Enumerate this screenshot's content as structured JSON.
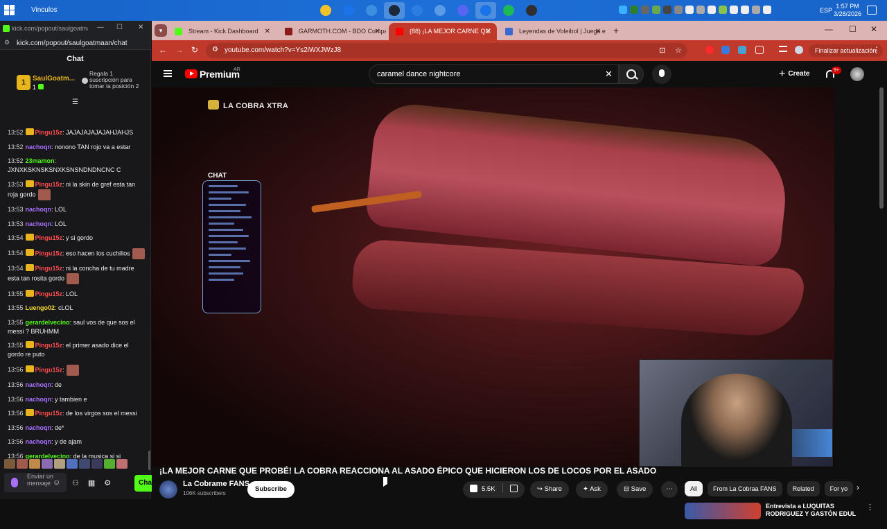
{
  "taskbar": {
    "window_title": "Vinculos",
    "language": "ESP",
    "time": "1:57 PM",
    "date": "3/28/2026",
    "apps": [
      "file-explorer-icon",
      "chrome-icon",
      "copilot-icon",
      "steam-icon",
      "store-icon",
      "photos-icon",
      "discord-icon",
      "chrome-alt-icon",
      "spotify-icon",
      "obs-icon"
    ]
  },
  "popup": {
    "title": "kick.com/popout/saulgoatma...",
    "url": "kick.com/popout/saulgoatmaan/chat",
    "chat_heading": "Chat",
    "pinned": {
      "badge": "1",
      "name": "SaulGoatm...",
      "count": "1",
      "text": "Regala 1 suscripción para tomar la posición 2"
    },
    "messages": [
      {
        "ts": "13:52",
        "user": "Pingu15z",
        "cls": "c-pingu",
        "crown": true,
        "text": ": JAJAJAJAJAJAHJAHJS"
      },
      {
        "ts": "13:52",
        "user": "nachoqn",
        "cls": "c-nacho",
        "crown": false,
        "text": ": nonono TAN rojo va a estar"
      },
      {
        "ts": "13:52",
        "user": "23mamon",
        "cls": "c-green",
        "crown": false,
        "text": ": JXNXKSKNSKSNXKSNSNDNDNCNC C"
      },
      {
        "ts": "13:53",
        "user": "Pingu15z",
        "cls": "c-pingu",
        "crown": true,
        "text": ": ni la skin de gref esta tan roja gordo",
        "emote": true
      },
      {
        "ts": "13:53",
        "user": "nachoqn",
        "cls": "c-nacho",
        "crown": false,
        "text": ": LOL"
      },
      {
        "ts": "13:53",
        "user": "nachoqn",
        "cls": "c-nacho",
        "crown": false,
        "text": ": LOL"
      },
      {
        "ts": "13:54",
        "user": "Pingu15z",
        "cls": "c-pingu",
        "crown": true,
        "text": ": y si gordo"
      },
      {
        "ts": "13:54",
        "user": "Pingu15z",
        "cls": "c-pingu",
        "crown": true,
        "text": ": eso hacen los cuchillos",
        "emote": true
      },
      {
        "ts": "13:54",
        "user": "Pingu15z",
        "cls": "c-pingu",
        "crown": true,
        "text": ": ni la concha de tu madre esta tan rosita gordo",
        "emote": true
      },
      {
        "ts": "13:55",
        "user": "Pingu15z",
        "cls": "c-pingu",
        "crown": true,
        "text": ": LOL"
      },
      {
        "ts": "13:55",
        "user": "Luengo02",
        "cls": "c-luengo",
        "crown": false,
        "text": ": cLOL"
      },
      {
        "ts": "13:55",
        "user": "gerardelvecino",
        "cls": "c-green",
        "crown": false,
        "text": ": saul vos de que sos el messi ? BRUHMM"
      },
      {
        "ts": "13:55",
        "user": "Pingu15z",
        "cls": "c-pingu",
        "crown": true,
        "text": ": el primer asado dice el gordo re puto"
      },
      {
        "ts": "13:56",
        "user": "Pingu15z",
        "cls": "c-pingu",
        "crown": true,
        "text": ":",
        "emote": true
      },
      {
        "ts": "13:56",
        "user": "nachoqn",
        "cls": "c-nacho",
        "crown": false,
        "text": ": de"
      },
      {
        "ts": "13:56",
        "user": "nachoqn",
        "cls": "c-nacho",
        "crown": false,
        "text": ": y tambien e"
      },
      {
        "ts": "13:56",
        "user": "Pingu15z",
        "cls": "c-pingu",
        "crown": true,
        "text": ": de los virgos sos el messi"
      },
      {
        "ts": "13:56",
        "user": "nachoqn",
        "cls": "c-nacho",
        "crown": false,
        "text": ": de*"
      },
      {
        "ts": "13:56",
        "user": "nachoqn",
        "cls": "c-nacho",
        "crown": false,
        "text": ": y de ajam"
      },
      {
        "ts": "13:56",
        "user": "gerardelvecino",
        "cls": "c-green",
        "crown": false,
        "text": ": de la musica si si"
      }
    ],
    "input_placeholder": "Enviar un mensaje",
    "send_label": "Chat"
  },
  "browser": {
    "tabs": [
      {
        "title": "Stream - Kick Dashboard",
        "color": "#53fc18",
        "active": false
      },
      {
        "title": "GARMOTH.COM - BDO Compa",
        "color": "#8b1a1a",
        "active": false
      },
      {
        "title": "(88) ¡LA MEJOR CARNE QU",
        "color": "#ff0000",
        "active": true
      },
      {
        "title": "Leyendas de Voleibol | Juega e",
        "color": "#3a6ad0",
        "active": false
      }
    ],
    "url": "youtube.com/watch?v=Ys2iWXJWzJ8",
    "update_label": "Finalizar actualización"
  },
  "youtube": {
    "brand": "Premium",
    "country": "AR",
    "search_query": "caramel dance nightcore",
    "create_label": "Create",
    "notif_count": "9+",
    "watermark": "LA COBRA XTRA",
    "chat_frame_label": "CHAT",
    "video_title": "¡LA MEJOR CARNE QUE PROBÉ! LA COBRA REACCIONA AL ASADO ÉPICO QUE HICIERON LOS DE LOCOS POR EL ASADO",
    "channel_name": "La Cobrame FANS",
    "subscribers": "106K subscribers",
    "subscribe_label": "Subscribe",
    "likes": "5.5K",
    "share_label": "Share",
    "ask_label": "Ask",
    "save_label": "Save",
    "chips": [
      "All",
      "From La Cobraa FANS",
      "Related",
      "For yo"
    ],
    "rec_title": "Entrevista a LUQUITAS RODRIGUEZ Y GASTÓN EDUL"
  }
}
